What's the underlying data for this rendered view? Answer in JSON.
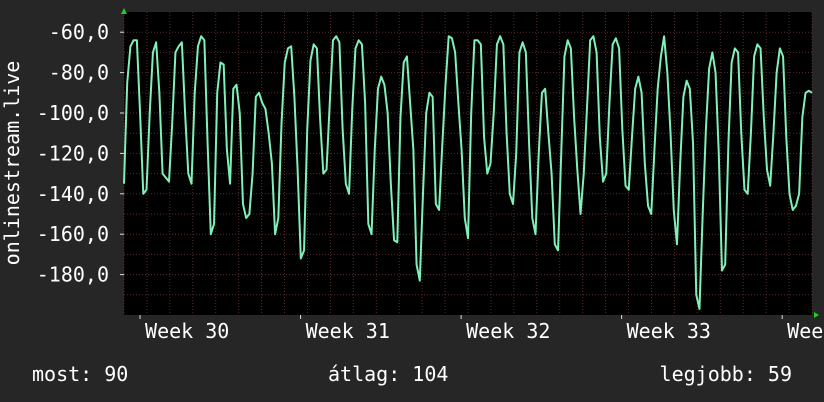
{
  "chart_data": {
    "type": "line",
    "ylabel": "onlinestream.live",
    "ylim": [
      -200,
      -50
    ],
    "y_ticks": [
      -60,
      -80,
      -100,
      -120,
      -140,
      -160,
      -180
    ],
    "y_tick_labels": [
      "-60,0",
      "-80,0",
      "-100,0",
      "-120,0",
      "-140,0",
      "-160,0",
      "-180,0"
    ],
    "x_ticks": [
      0.7,
      7.7,
      14.7,
      21.7,
      28.7
    ],
    "x_tick_labels": [
      "Week 30",
      "Week 31",
      "Week 32",
      "Week 33",
      "Week"
    ],
    "xlim": [
      0,
      30
    ],
    "grid": true,
    "background_color": "#262626",
    "plot_background_color": "#000000",
    "grid_color": "#5a2a2a",
    "line_color": "#7ff0b8",
    "series": [
      {
        "values": [
          -135,
          -85,
          -67,
          -64,
          -64,
          -100,
          -140,
          -138,
          -100,
          -70,
          -65,
          -90,
          -130,
          -132,
          -134,
          -105,
          -70,
          -67,
          -65,
          -100,
          -130,
          -135,
          -90,
          -67,
          -62,
          -64,
          -115,
          -160,
          -155,
          -90,
          -75,
          -76,
          -118,
          -135,
          -88,
          -86,
          -100,
          -145,
          -152,
          -150,
          -130,
          -92,
          -90,
          -95,
          -98,
          -110,
          -125,
          -160,
          -152,
          -105,
          -75,
          -68,
          -67,
          -92,
          -128,
          -172,
          -168,
          -108,
          -74,
          -66,
          -68,
          -103,
          -130,
          -128,
          -95,
          -64,
          -62,
          -65,
          -108,
          -135,
          -140,
          -98,
          -68,
          -64,
          -66,
          -95,
          -155,
          -160,
          -118,
          -88,
          -82,
          -86,
          -100,
          -135,
          -163,
          -164,
          -102,
          -75,
          -72,
          -95,
          -118,
          -175,
          -183,
          -140,
          -100,
          -90,
          -92,
          -145,
          -148,
          -116,
          -86,
          -62,
          -63,
          -70,
          -95,
          -118,
          -152,
          -162,
          -100,
          -64,
          -64,
          -66,
          -112,
          -130,
          -125,
          -100,
          -66,
          -62,
          -66,
          -110,
          -140,
          -145,
          -120,
          -70,
          -65,
          -70,
          -115,
          -152,
          -160,
          -120,
          -90,
          -88,
          -110,
          -130,
          -165,
          -168,
          -120,
          -72,
          -64,
          -68,
          -102,
          -128,
          -150,
          -130,
          -98,
          -64,
          -62,
          -70,
          -112,
          -134,
          -130,
          -95,
          -66,
          -63,
          -68,
          -108,
          -136,
          -138,
          -112,
          -88,
          -82,
          -90,
          -125,
          -146,
          -150,
          -118,
          -88,
          -72,
          -62,
          -80,
          -110,
          -148,
          -165,
          -125,
          -92,
          -84,
          -88,
          -115,
          -190,
          -197,
          -150,
          -108,
          -78,
          -70,
          -80,
          -120,
          -178,
          -175,
          -115,
          -75,
          -68,
          -70,
          -110,
          -138,
          -140,
          -110,
          -72,
          -66,
          -68,
          -102,
          -128,
          -136,
          -110,
          -80,
          -68,
          -72,
          -112,
          -140,
          -148,
          -146,
          -140,
          -102,
          -90,
          -89,
          -90
        ]
      }
    ]
  },
  "stats": {
    "current": "most: 90",
    "average": "átlag: 104",
    "best": "legjobb: 59"
  }
}
